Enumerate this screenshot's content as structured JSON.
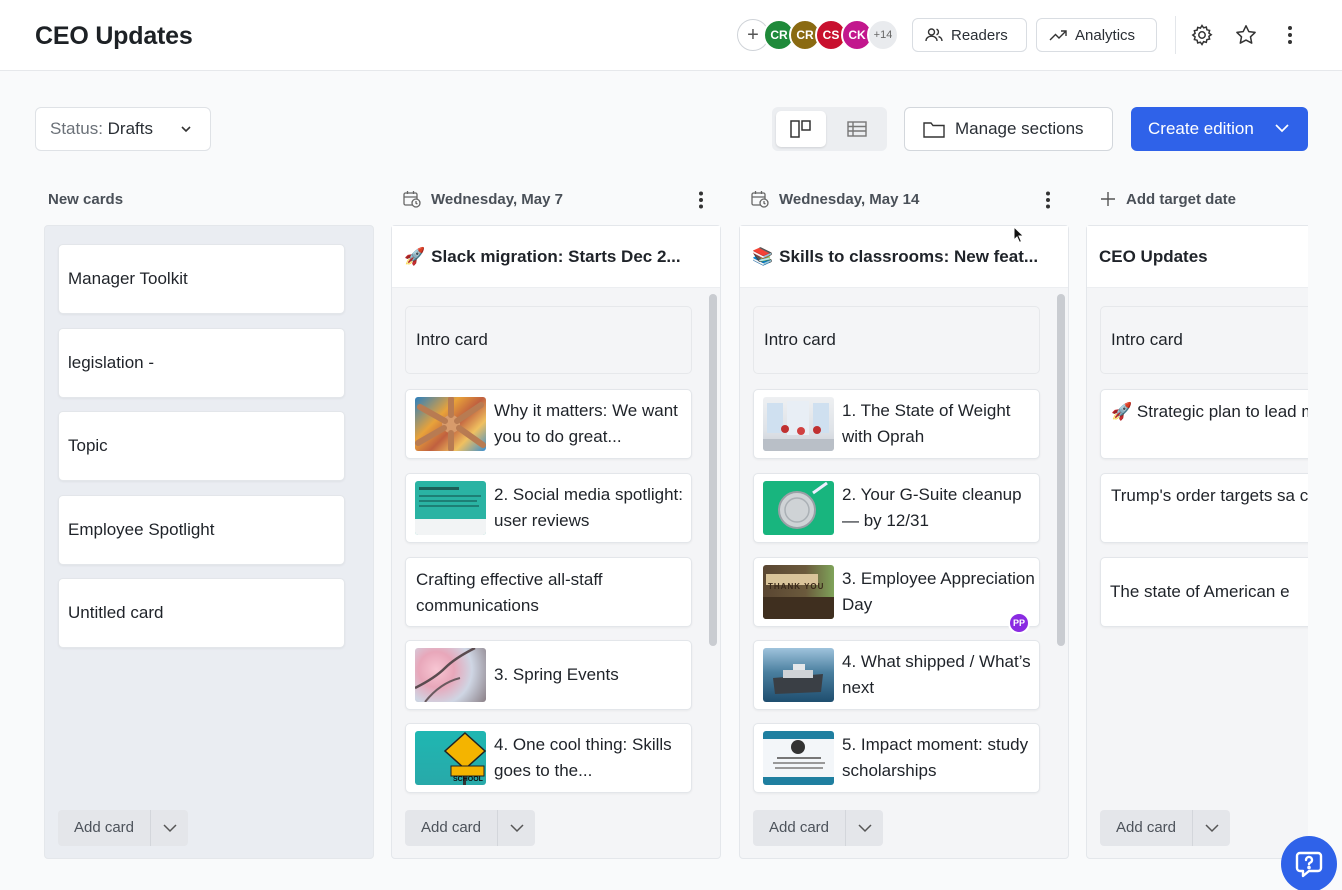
{
  "header": {
    "title": "CEO Updates",
    "avatars": [
      {
        "initials": "CR",
        "color": "#1f8a3a"
      },
      {
        "initials": "CR",
        "color": "#8a6a12"
      },
      {
        "initials": "CS",
        "color": "#c8102e"
      },
      {
        "initials": "CK",
        "color": "#c2178d"
      }
    ],
    "more_count": "+14",
    "readers_label": "Readers",
    "analytics_label": "Analytics"
  },
  "toolbar": {
    "status_key": "Status:",
    "status_value": "Drafts",
    "manage_label": "Manage sections",
    "create_label": "Create edition"
  },
  "columns": {
    "new": {
      "header": "New cards",
      "cards": [
        "Manager Toolkit",
        "legislation -",
        "Topic",
        "Employee Spotlight",
        "Untitled card"
      ],
      "add_label": "Add card"
    },
    "may7": {
      "header": "Wednesday, May 7",
      "title_emoji": "🚀",
      "title": "Slack migration: Starts Dec 2...",
      "intro": "Intro card",
      "cards": [
        "Why it matters: We want you to do great...",
        "2. Social media spotlight: user reviews",
        "Crafting effective all-staff communications",
        "3. Spring Events",
        "4. One cool thing: Skills goes to the..."
      ],
      "add_label": "Add card"
    },
    "may14": {
      "header": "Wednesday, May 14",
      "title_emoji": "📚",
      "title": "Skills to classrooms: New feat...",
      "intro": "Intro card",
      "cards": [
        "1. The State of Weight with Oprah",
        "2. Your G-Suite cleanup — by 12/31",
        "3. Employee Appreciation Day",
        "4. What shipped / What’s next",
        "5. Impact moment: study scholarships"
      ],
      "badge": "PP",
      "add_label": "Add card"
    },
    "target": {
      "header": "Add target date",
      "title": "CEO Updates",
      "intro": "Intro card",
      "cards": [
        "🚀 Strategic plan to lead market",
        "Trump's order targets sa cities",
        "The state of American e"
      ],
      "add_label": "Add card"
    }
  },
  "thumb_text": {
    "thank_you": "THANK YOU",
    "school": "SCHOOL"
  }
}
